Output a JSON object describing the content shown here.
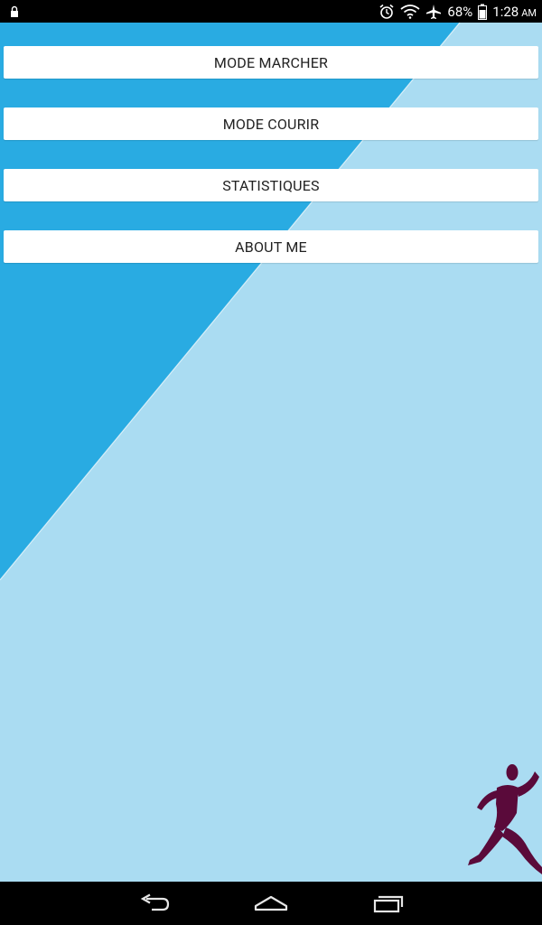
{
  "status_bar": {
    "battery": "68%",
    "time": "1:28",
    "ampm": "AM",
    "icons": [
      "lock-icon",
      "alarm-icon",
      "wifi-icon",
      "airplane-icon",
      "battery-icon"
    ]
  },
  "menu": {
    "buttons": [
      {
        "label": "MODE MARCHER"
      },
      {
        "label": "MODE COURIR"
      },
      {
        "label": "STATISTIQUES"
      },
      {
        "label": "ABOUT ME"
      }
    ]
  },
  "colors": {
    "background_light": "#aadcf2",
    "background_dark": "#29abe2",
    "runner": "#5a0a3a",
    "bars": "#000000"
  },
  "nav_bar": {
    "icons": [
      "back-icon",
      "home-icon",
      "recent-apps-icon"
    ]
  }
}
